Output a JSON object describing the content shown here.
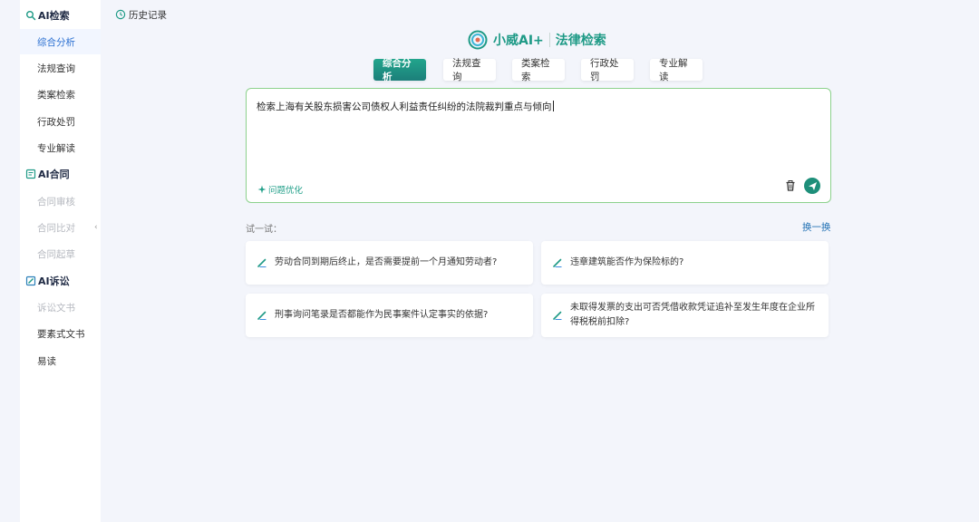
{
  "sidebar": {
    "sections": [
      {
        "title": "AI检索",
        "icon": "search-icon"
      },
      {
        "title": "AI合同",
        "icon": "contract-icon"
      },
      {
        "title": "AI诉讼",
        "icon": "litigation-icon"
      }
    ],
    "items": [
      {
        "label": "综合分析",
        "state": "active"
      },
      {
        "label": "法规查询",
        "state": "normal"
      },
      {
        "label": "类案检索",
        "state": "normal"
      },
      {
        "label": "行政处罚",
        "state": "normal"
      },
      {
        "label": "专业解读",
        "state": "normal"
      },
      {
        "label": "合同审核",
        "state": "disabled"
      },
      {
        "label": "合同比对",
        "state": "disabled"
      },
      {
        "label": "合同起草",
        "state": "disabled"
      },
      {
        "label": "诉讼文书",
        "state": "disabled"
      },
      {
        "label": "要素式文书",
        "state": "normal"
      },
      {
        "label": "易读",
        "state": "normal"
      }
    ],
    "collapse_arrow": "‹"
  },
  "header": {
    "history_label": "历史记录",
    "brand_name": "小威AI+",
    "brand_title": "法律检索"
  },
  "tabs": [
    {
      "label": "综合分析",
      "active": true
    },
    {
      "label": "法规查询",
      "active": false
    },
    {
      "label": "类案检索",
      "active": false
    },
    {
      "label": "行政处罚",
      "active": false
    },
    {
      "label": "专业解读",
      "active": false
    }
  ],
  "query": {
    "value": "检索上海有关股东损害公司债权人利益责任纠纷的法院裁判重点与倾向",
    "optimize_label": "问题优化"
  },
  "suggestions": {
    "label": "试一试：",
    "refresh_label": "换一换",
    "items": [
      "劳动合同到期后终止，是否需要提前一个月通知劳动者?",
      "违章建筑能否作为保险标的?",
      "刑事询问笔录是否都能作为民事案件认定事实的依据?",
      "未取得发票的支出可否凭借收款凭证追补至发生年度在企业所得税税前扣除?"
    ]
  },
  "colors": {
    "accent": "#1e9a86",
    "active_sidebar": "#2a6fd1",
    "link": "#1e6fb3",
    "input_border": "#8cd18c"
  }
}
